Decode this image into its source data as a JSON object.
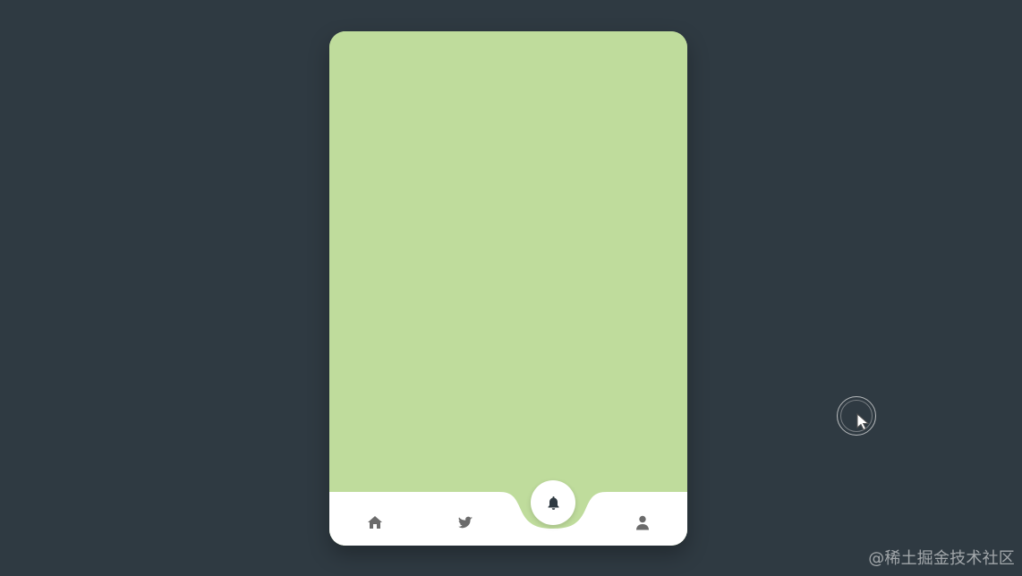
{
  "app": {
    "background_color": "#2f3a42",
    "card_color": "#bfdc9c",
    "nav_bar_color": "#ffffff",
    "icon_color": "#6b6b6b",
    "active_icon_color": "#2f3a42"
  },
  "bottom_nav": {
    "items": [
      {
        "icon": "home-icon"
      },
      {
        "icon": "twitter-icon"
      },
      {
        "icon": "bell-icon",
        "active": true
      },
      {
        "icon": "user-icon"
      }
    ]
  },
  "overlay": {
    "watermark": "@稀土掘金技术社区"
  }
}
